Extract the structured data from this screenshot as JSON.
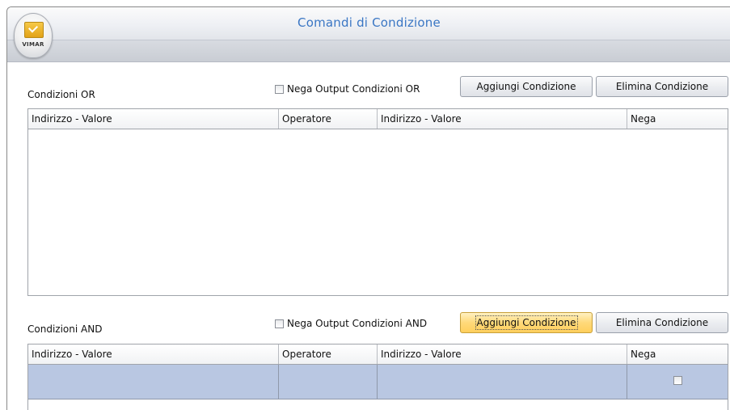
{
  "window": {
    "title": "Comandi di Condizione",
    "logo_text": "VIMAR"
  },
  "or_section": {
    "label": "Condizioni OR",
    "negate_checkbox_label": "Nega Output Condizioni OR",
    "negate_checked": false,
    "add_button": "Aggiungi Condizione",
    "remove_button": "Elimina Condizione",
    "columns": [
      "Indirizzo - Valore",
      "Operatore",
      "Indirizzo - Valore",
      "Nega"
    ],
    "rows": []
  },
  "and_section": {
    "label": "Condizioni AND",
    "negate_checkbox_label": "Nega Output Condizioni AND",
    "negate_checked": false,
    "add_button": "Aggiungi Condizione",
    "remove_button": "Elimina Condizione",
    "columns": [
      "Indirizzo - Valore",
      "Operatore",
      "Indirizzo - Valore",
      "Nega"
    ],
    "rows": [
      {
        "address_value_1": "",
        "operator": "",
        "address_value_2": "",
        "negate": false
      }
    ]
  },
  "colors": {
    "title_text": "#3a76c4",
    "selected_row": "#b9c7e2",
    "focused_button": "#ffd979"
  }
}
